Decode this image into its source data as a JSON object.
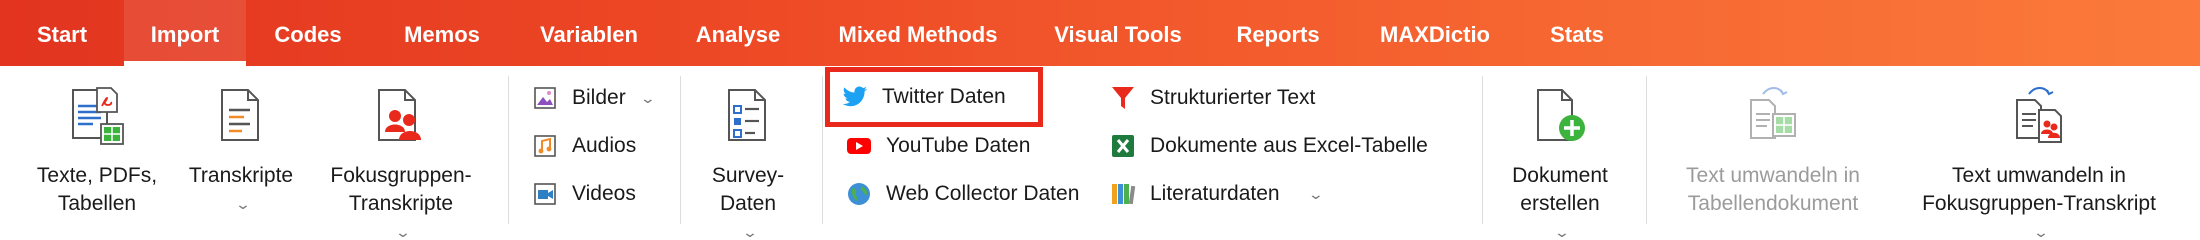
{
  "menu": {
    "tabs": [
      "Start",
      "Import",
      "Codes",
      "Memos",
      "Variablen",
      "Analyse",
      "Mixed Methods",
      "Visual Tools",
      "Reports",
      "MAXDictio",
      "Stats"
    ],
    "active": "Import"
  },
  "ribbon": {
    "texte": {
      "line1": "Texte, PDFs,",
      "line2": "Tabellen"
    },
    "transkripte": {
      "line1": "Transkripte"
    },
    "fokus": {
      "line1": "Fokusgruppen-",
      "line2": "Transkripte"
    },
    "bilder": "Bilder",
    "audios": "Audios",
    "videos": "Videos",
    "survey": {
      "line1": "Survey-",
      "line2": "Daten"
    },
    "twitter": "Twitter Daten",
    "youtube": "YouTube Daten",
    "webcollector": "Web Collector Daten",
    "strukturiert": "Strukturierter Text",
    "excel": "Dokumente aus Excel-Tabelle",
    "literatur": "Literaturdaten",
    "dokument": {
      "line1": "Dokument",
      "line2": "erstellen"
    },
    "umwandeln_tabelle": {
      "line1": "Text umwandeln in",
      "line2": "Tabellendokument"
    },
    "umwandeln_fokus": {
      "line1": "Text umwandeln in",
      "line2": "Fokusgruppen-Transkript"
    }
  },
  "colors": {
    "menubar_start": "#e2341f",
    "menubar_end": "#fb7a3b",
    "highlight": "#e8291c",
    "twitter": "#1da1f2",
    "youtube": "#ff0000",
    "excel": "#1f7a3d",
    "add_green": "#3cb33c"
  }
}
